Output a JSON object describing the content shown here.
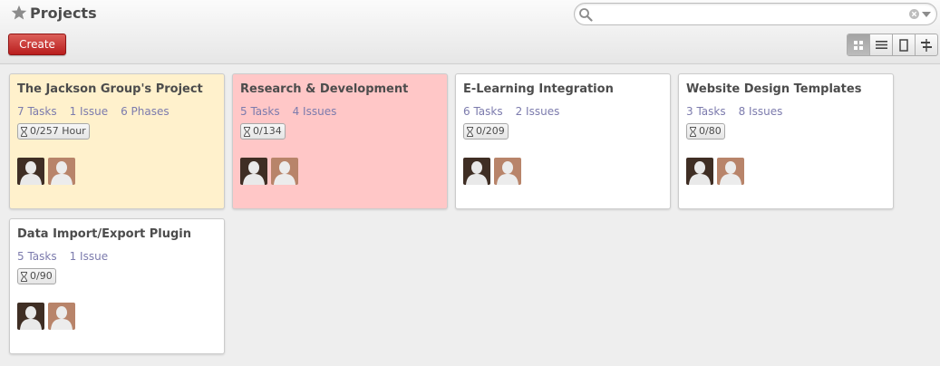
{
  "header": {
    "title": "Projects",
    "create_label": "Create",
    "search": {
      "value": "",
      "placeholder": ""
    },
    "views": [
      "kanban-view",
      "list-view",
      "form-view",
      "gantt-view"
    ],
    "active_view": "kanban-view"
  },
  "colors": {
    "create_button": "#c12a24",
    "card_yellow": "#fff1cc",
    "card_red": "#ffc7c7",
    "link": "#7c7bad",
    "avatar_dark": "#3f2e24",
    "avatar_light": "#b8846a"
  },
  "projects": [
    {
      "name": "The Jackson Group's Project",
      "links": [
        "7 Tasks",
        "1 Issue",
        "6 Phases"
      ],
      "hours": "0/257 Hour",
      "color": "yellow"
    },
    {
      "name": "Research & Development",
      "links": [
        "5 Tasks",
        "4 Issues"
      ],
      "hours": "0/134",
      "color": "red"
    },
    {
      "name": "E-Learning Integration",
      "links": [
        "6 Tasks",
        "2 Issues"
      ],
      "hours": "0/209",
      "color": "white"
    },
    {
      "name": "Website Design Templates",
      "links": [
        "3 Tasks",
        "8 Issues"
      ],
      "hours": "0/80",
      "color": "white"
    },
    {
      "name": "Data Import/Export Plugin",
      "links": [
        "5 Tasks",
        "1 Issue"
      ],
      "hours": "0/90",
      "color": "white"
    }
  ]
}
